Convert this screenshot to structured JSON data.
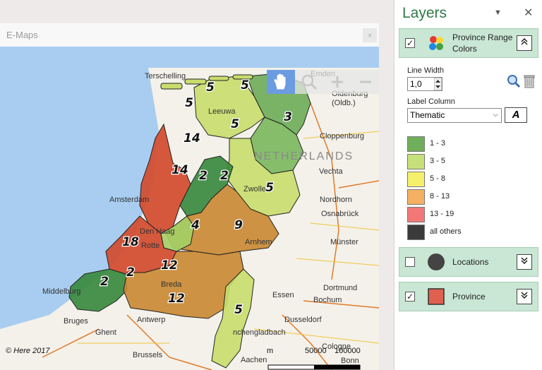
{
  "map_window": {
    "title": "E-Maps",
    "close_glyph": "×",
    "copyright": "© Here 2017",
    "scale": {
      "unit": "m",
      "mark1": "50000",
      "mark2": "100000"
    },
    "toolbar": [
      {
        "name": "pan-hand-icon",
        "state": "active"
      },
      {
        "name": "zoom-magnifier-icon",
        "state": "inactive"
      },
      {
        "name": "zoom-in-plus-icon",
        "state": "inactive"
      },
      {
        "name": "zoom-out-minus-icon",
        "state": "inactive"
      }
    ],
    "colors": {
      "sea": "#a8cdf0",
      "land": "#f4f1ea",
      "active_tool": "#6b9be0"
    },
    "place_labels": [
      {
        "id": "terschelling",
        "text": "Terschelling"
      },
      {
        "id": "emden",
        "text": "Emden"
      },
      {
        "id": "leeuwarden",
        "text": "Leeuwa"
      },
      {
        "id": "groningen",
        "text": "Gron"
      },
      {
        "id": "oldenburg",
        "text": "Oldenburg\n(Oldb.)"
      },
      {
        "id": "netherlands",
        "text": "NETHERLANDS"
      },
      {
        "id": "cloppenburg",
        "text": "Cloppenburg"
      },
      {
        "id": "vechta",
        "text": "Vechta"
      },
      {
        "id": "zwolle",
        "text": "Zwolle"
      },
      {
        "id": "amsterdam",
        "text": "Amsterdam"
      },
      {
        "id": "nordhorn",
        "text": "Nordhorn"
      },
      {
        "id": "osnabruck",
        "text": "Osnabrück"
      },
      {
        "id": "denhaag",
        "text": "Den Haag"
      },
      {
        "id": "arnhem",
        "text": "Arnhem"
      },
      {
        "id": "rotterdam",
        "text": "Rotte"
      },
      {
        "id": "munster",
        "text": "Münster"
      },
      {
        "id": "breda",
        "text": "Breda"
      },
      {
        "id": "middelburg",
        "text": "Middelburg"
      },
      {
        "id": "essen",
        "text": "Essen"
      },
      {
        "id": "dortmund",
        "text": "Dortmund"
      },
      {
        "id": "bochum",
        "text": "Bochum"
      },
      {
        "id": "antwerp",
        "text": "Antwerp"
      },
      {
        "id": "dusseldorf",
        "text": "Dusseldorf"
      },
      {
        "id": "bruges",
        "text": "Bruges"
      },
      {
        "id": "ghent",
        "text": "Ghent"
      },
      {
        "id": "monchengladbach",
        "text": "nchengladbach"
      },
      {
        "id": "brussels",
        "text": "Brussels"
      },
      {
        "id": "cologne",
        "text": "Cologne"
      },
      {
        "id": "aachen",
        "text": "Aachen"
      },
      {
        "id": "bonn",
        "text": "Bonn"
      }
    ],
    "provinces": [
      {
        "id": "groningen",
        "count": "3",
        "color": "#6fae5a"
      },
      {
        "id": "friesland",
        "count": "5",
        "color": "#c8dd6e"
      },
      {
        "id": "drenthe",
        "count": "",
        "color": "#7cb85e"
      },
      {
        "id": "overijssel",
        "count": "5",
        "color": "#c8dd6e"
      },
      {
        "id": "flevoland",
        "count": "2",
        "color": "#3a8a3f"
      },
      {
        "id": "noord-holland",
        "count": "14",
        "color": "#d24b2c"
      },
      {
        "id": "gelderland",
        "count": "9",
        "color": "#c98a34"
      },
      {
        "id": "utrecht",
        "count": "4",
        "color": "#a5cf66"
      },
      {
        "id": "zuid-holland",
        "count": "18",
        "color": "#d24b2c"
      },
      {
        "id": "zeeland",
        "count": "2",
        "color": "#3a8a3f"
      },
      {
        "id": "noord-brabant",
        "count": "12",
        "color": "#c98a34"
      },
      {
        "id": "limburg",
        "count": "5",
        "color": "#c8dd6e"
      }
    ],
    "extra_counts": [
      {
        "id": "wadden-west",
        "count": "5"
      },
      {
        "id": "wadden-mid",
        "count": "5"
      },
      {
        "id": "wadden-east",
        "count": "5"
      },
      {
        "id": "texel",
        "count": "14"
      },
      {
        "id": "markermeer",
        "count": "2"
      },
      {
        "id": "hoekse",
        "count": "2"
      },
      {
        "id": "brabant-west",
        "count": "12"
      }
    ]
  },
  "layers_panel": {
    "title": "Layers",
    "dropdown_glyph": "▼",
    "close_glyph": "✕",
    "layers": [
      {
        "id": "province-range-colors",
        "name_line1": "Province Range",
        "name_line2": "Colors",
        "checked": true,
        "checkmark": "✓",
        "expand_glyph": "⌃"
      },
      {
        "id": "locations",
        "name_line1": "Locations",
        "checked": false,
        "checkmark": "",
        "expand_glyph": "⌄"
      },
      {
        "id": "province",
        "name_line1": "Province",
        "checked": true,
        "checkmark": "✓",
        "expand_glyph": "⌄"
      }
    ],
    "settings": {
      "line_width_label": "Line Width",
      "line_width_value": "1,0",
      "label_column_label": "Label Column",
      "label_column_value": "Thematic",
      "font_button_glyph": "A",
      "legend": [
        {
          "label": "1 - 3",
          "color": "#6fae5a"
        },
        {
          "label": "3 - 5",
          "color": "#c8e07a"
        },
        {
          "label": "5 - 8",
          "color": "#f5f06a"
        },
        {
          "label": "8 - 13",
          "color": "#f5b063"
        },
        {
          "label": "13 - 19",
          "color": "#f27878"
        },
        {
          "label": "all others",
          "color": "#3a3a3a"
        }
      ]
    },
    "colors": {
      "card_bg": "#c9e7d4",
      "title": "#2f7a47",
      "locations_dot": "#444444",
      "province_swatch": "#e06050"
    }
  }
}
